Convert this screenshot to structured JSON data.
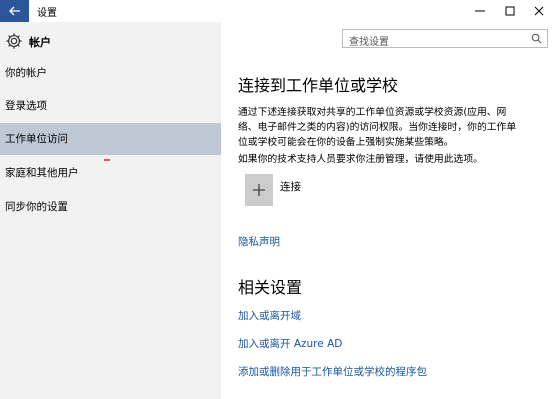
{
  "window": {
    "title": "设置",
    "back_icon": "arrow-left-icon",
    "controls": [
      "minimize-icon",
      "maximize-icon",
      "close-icon"
    ]
  },
  "sidebar": {
    "header": {
      "icon": "gear-icon",
      "label": "帐户"
    },
    "items": [
      {
        "label": "你的帐户",
        "active": false
      },
      {
        "label": "登录选项",
        "active": false
      },
      {
        "label": "工作单位访问",
        "active": true
      },
      {
        "label": "家庭和其他用户",
        "active": false
      },
      {
        "label": "同步你的设置",
        "active": false
      }
    ]
  },
  "search": {
    "placeholder": "查找设置",
    "icon": "search-icon"
  },
  "main": {
    "title": "连接到工作单位或学校",
    "description_lines": [
      "通过下述连接获取对共享的工作单位资源或学校资源(应用、网",
      "络、电子邮件之类的内容)的访问权限。当你连接时，你的工作单",
      "位或学校可能会在你的设备上强制实施某些策略。"
    ],
    "note": "如果你的技术支持人员要求你注册管理，请使用此选项。",
    "connect": {
      "icon": "plus-icon",
      "label": "连接"
    },
    "privacy_link": "隐私声明",
    "related_title": "相关设置",
    "related_links": [
      "加入或离开域",
      "加入或离开 Azure AD",
      "添加或删除用于工作单位或学校的程序包"
    ]
  },
  "colors": {
    "accent": "#2b579a",
    "sidebar_bg": "#f2f2f2",
    "active_item_bg": "#bfc9d6",
    "link": "#1a56a8"
  }
}
